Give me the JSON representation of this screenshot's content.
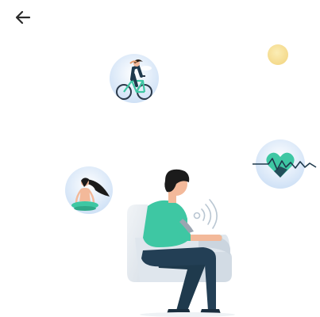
{
  "header": {
    "back_icon": "arrow-left-icon"
  },
  "illustration": {
    "sun_icon": "sun-icon",
    "cyclist_icon": "cyclist-icon",
    "meditation_icon": "meditation-icon",
    "heart_rate_icon": "heart-rate-icon",
    "wireless_icon": "wireless-signal-icon",
    "person": "seated-person-illustration",
    "colors": {
      "accent_teal": "#3ec7a3",
      "dark_navy": "#1f3a4d",
      "skin": "#f3b99a",
      "hair": "#1b1b1b",
      "sun": "#f7df8c",
      "chair": "#e2e8ee",
      "circle_bg": "#dde9f7"
    }
  }
}
